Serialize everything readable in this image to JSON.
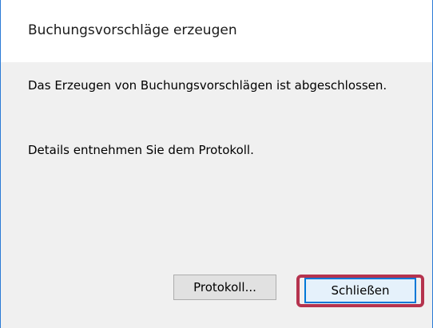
{
  "dialog": {
    "title": "Buchungsvorschläge erzeugen",
    "message_line1": "Das Erzeugen von Buchungsvorschlägen ist abgeschlossen.",
    "message_line2": "Details entnehmen Sie dem Protokoll.",
    "buttons": {
      "protokoll_label": "Protokoll...",
      "close_label": "Schließen"
    }
  },
  "colors": {
    "window_border": "#2b7bd6",
    "highlight_ring": "#b5334e",
    "default_button_border": "#0078d7"
  }
}
